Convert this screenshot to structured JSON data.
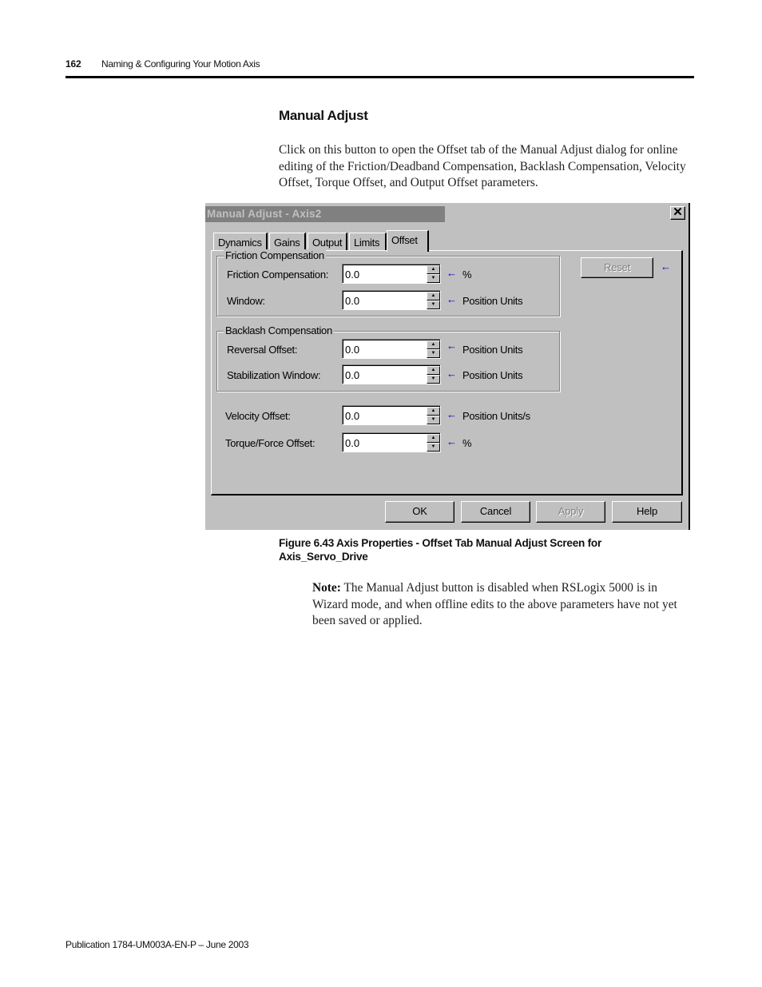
{
  "header": {
    "page_number": "162",
    "running_head": "Naming & Configuring Your Motion Axis"
  },
  "section": {
    "title": "Manual Adjust",
    "paragraph": "Click on this button to open the Offset tab of the Manual Adjust dialog for online editing of the Friction/Deadband Compensation, Backlash Compensation, Velocity Offset, Torque Offset, and Output Offset parameters."
  },
  "dialog": {
    "title": "Manual Adjust - Axis2",
    "close_glyph": "✕",
    "tabs": [
      {
        "label": "Dynamics",
        "active": false
      },
      {
        "label": "Gains",
        "active": false
      },
      {
        "label": "Output",
        "active": false
      },
      {
        "label": "Limits",
        "active": false
      },
      {
        "label": "Offset",
        "active": true
      }
    ],
    "groups": {
      "friction": {
        "label": "Friction Compensation",
        "fields": [
          {
            "label": "Friction Compensation:",
            "value": "0.0",
            "units": "%"
          },
          {
            "label": "Window:",
            "value": "0.0",
            "units": "Position Units"
          }
        ]
      },
      "backlash": {
        "label": "Backlash Compensation",
        "fields": [
          {
            "label": "Reversal Offset:",
            "value": "0.0",
            "units": "Position Units"
          },
          {
            "label": "Stabilization Window:",
            "value": "0.0",
            "units": "Position Units"
          }
        ]
      }
    },
    "standalone_fields": [
      {
        "label": "Velocity Offset:",
        "value": "0.0",
        "units": "Position Units/s"
      },
      {
        "label": "Torque/Force Offset:",
        "value": "0.0",
        "units": "%"
      }
    ],
    "reset_button": {
      "label": "Reset",
      "enabled": false
    },
    "arrow_glyph": "🡐",
    "spin_up_glyph": "▲",
    "spin_down_glyph": "▼",
    "buttons": [
      {
        "label": "OK",
        "enabled": true
      },
      {
        "label": "Cancel",
        "enabled": true
      },
      {
        "label": "Apply",
        "enabled": false
      },
      {
        "label": "Help",
        "enabled": true
      }
    ],
    "accent_color": "#0000cc"
  },
  "caption": "Figure 6.43 Axis Properties - Offset Tab Manual Adjust Screen for Axis_Servo_Drive",
  "note": {
    "label": "Note:",
    "text": " The Manual Adjust button is disabled when RSLogix 5000 is in Wizard mode, and when offline edits to the above parameters have not yet been saved or applied."
  },
  "footer": "Publication 1784-UM003A-EN-P – June 2003"
}
